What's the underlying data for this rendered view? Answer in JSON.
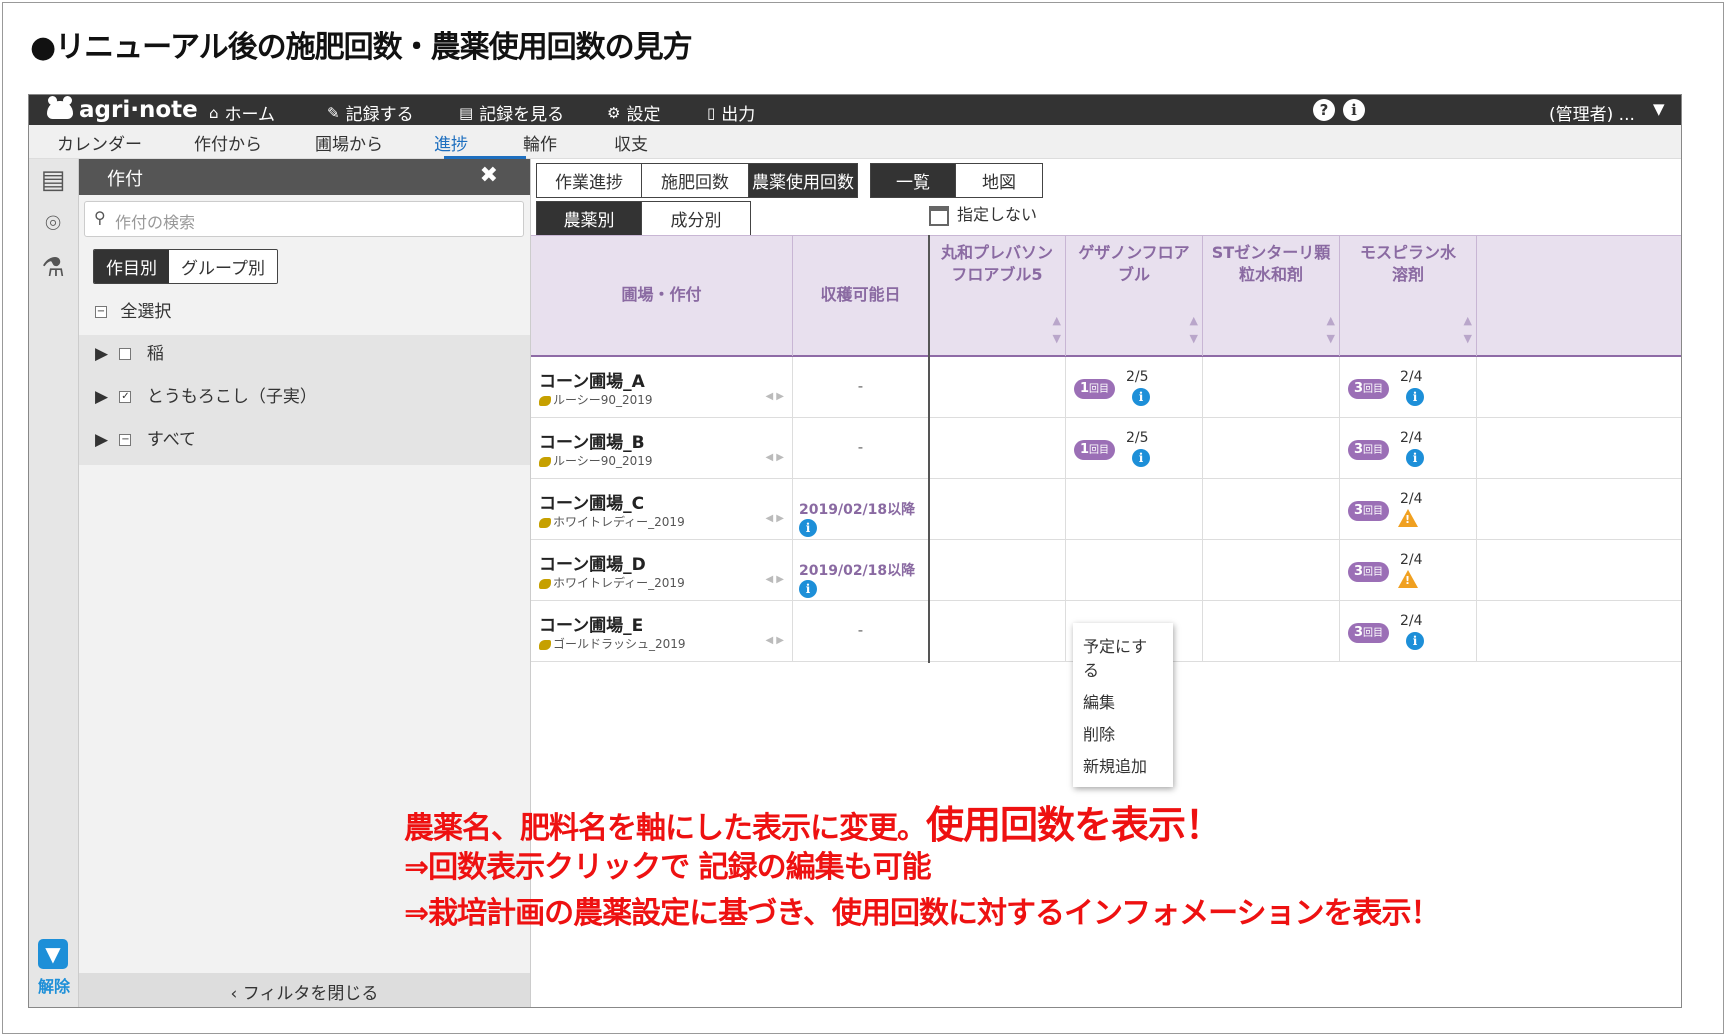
{
  "slide_title": "●リニューアル後の施肥回数・農薬使用回数の見方",
  "app": {
    "logo": "agri·note",
    "topnav": [
      {
        "icon": "home-icon",
        "glyph": "⌂",
        "label": "ホーム"
      },
      {
        "icon": "pencil-icon",
        "glyph": "✎",
        "label": "記録する"
      },
      {
        "icon": "document-icon",
        "glyph": "▤",
        "label": "記録を見る"
      },
      {
        "icon": "gear-icon",
        "glyph": "⚙",
        "label": "設定"
      },
      {
        "icon": "file-icon",
        "glyph": "▯",
        "label": "出力"
      }
    ],
    "help": "?",
    "info": "i",
    "user": "(管理者) ...",
    "subnav": [
      "カレンダー",
      "作付から",
      "圃場から",
      "進捗",
      "輪作",
      "収支"
    ],
    "active_subnav": "進捗"
  },
  "filter_panel": {
    "title": "作付",
    "close": "✖",
    "search_placeholder": "作付の検索",
    "group_tabs": [
      "作目別",
      "グループ別"
    ],
    "select_all": "全選択",
    "tree": [
      {
        "label": "稲",
        "check": ""
      },
      {
        "label": "とうもろこし（子実）",
        "check": "✓"
      },
      {
        "label": "すべて",
        "check": "−"
      }
    ],
    "footer": "フィルタを閉じる",
    "filter_release": "解除"
  },
  "main": {
    "view_tabs": [
      "作業進捗",
      "施肥回数",
      "農薬使用回数"
    ],
    "view_tabs_active": 2,
    "layout_tabs": [
      "一覧",
      "地図"
    ],
    "layout_tabs_active": 0,
    "by_tabs": [
      "農薬別",
      "成分別"
    ],
    "by_tabs_active": 0,
    "date_filter": "指定しない",
    "columns": {
      "field": "圃場・作付",
      "harvest": "収穫可能日",
      "chemicals": [
        "丸和プレバソンフロアブル5",
        "ゲザノンフロアブル",
        "STゼンターリ顆粒水和剤",
        "モスピラン水溶剤"
      ]
    },
    "rows": [
      {
        "field": "コーン圃場_A",
        "crop": "ルーシー90_2019",
        "harvest": "-",
        "c2": {
          "badge": "1",
          "count": "2/5",
          "status": "info"
        },
        "c4": {
          "badge": "3",
          "count": "2/4",
          "status": "info"
        }
      },
      {
        "field": "コーン圃場_B",
        "crop": "ルーシー90_2019",
        "harvest": "-",
        "c2": {
          "badge": "1",
          "count": "2/5",
          "status": "info"
        },
        "c4": {
          "badge": "3",
          "count": "2/4",
          "status": "info"
        }
      },
      {
        "field": "コーン圃場_C",
        "crop": "ホワイトレディー_2019",
        "harvest": "2019/02/18以降",
        "c2": null,
        "c4": {
          "badge": "3",
          "count": "2/4",
          "status": "warn"
        }
      },
      {
        "field": "コーン圃場_D",
        "crop": "ホワイトレディー_2019",
        "harvest": "2019/02/18以降",
        "c2": null,
        "c4": {
          "badge": "3",
          "count": "2/4",
          "status": "warn"
        }
      },
      {
        "field": "コーン圃場_E",
        "crop": "ゴールドラッシュ_2019",
        "harvest": "-",
        "c2": null,
        "c4": {
          "badge": "3",
          "count": "2/4",
          "status": "info"
        }
      }
    ],
    "badge_suffix": "回目",
    "context_menu": [
      "予定にする",
      "編集",
      "削除",
      "新規追加"
    ]
  },
  "annotation": {
    "line1a": "農薬名、肥料名を軸にした表示に変更。",
    "line1b": "使用回数を表示！",
    "line2": "⇒回数表示クリックで 記録の編集も可能",
    "line3": "⇒栽培計画の農薬設定に基づき、使用回数に対するインフォメーションを表示！"
  }
}
